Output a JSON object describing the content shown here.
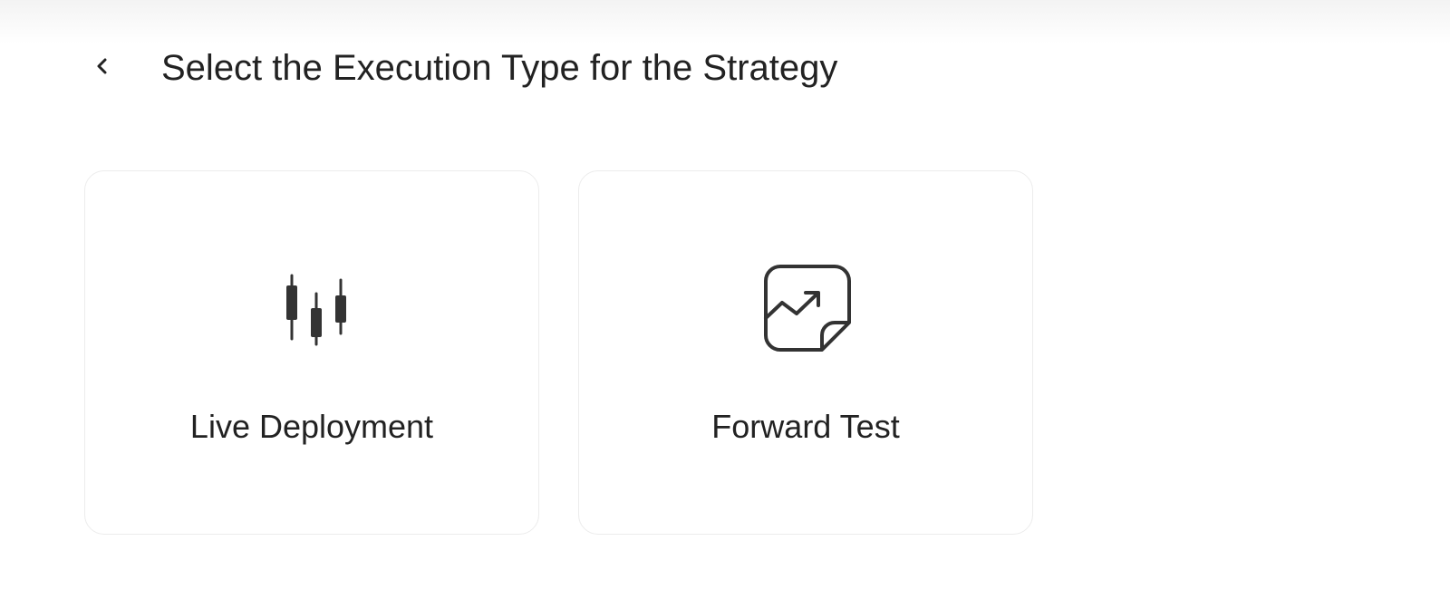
{
  "header": {
    "back_icon": "chevron-left-icon",
    "title": "Select the Execution Type for the Strategy"
  },
  "options": [
    {
      "label": "Live Deployment",
      "icon": "candlestick-icon"
    },
    {
      "label": "Forward Test",
      "icon": "trend-note-icon"
    }
  ],
  "colors": {
    "text": "#222222",
    "icon": "#333333",
    "card_border": "#ececec",
    "background": "#ffffff"
  }
}
